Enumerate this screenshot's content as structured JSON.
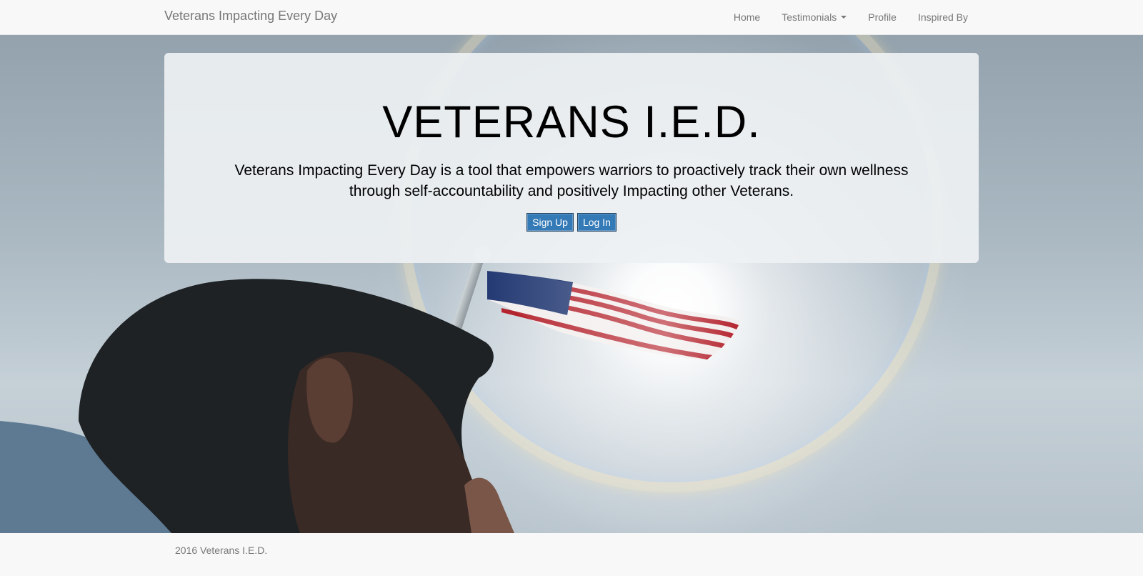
{
  "navbar": {
    "brand": "Veterans Impacting Every Day",
    "items": [
      {
        "label": "Home"
      },
      {
        "label": "Testimonials",
        "dropdown": true
      },
      {
        "label": "Profile"
      },
      {
        "label": "Inspired By"
      }
    ]
  },
  "hero": {
    "title": "VETERANS I.E.D.",
    "description": "Veterans Impacting Every Day is a tool that empowers warriors to proactively track their own wellness through self-accountability and positively Impacting other Veterans.",
    "signup_label": "Sign Up",
    "login_label": "Log In"
  },
  "footer": {
    "text": "2016 Veterans I.E.D."
  },
  "colors": {
    "navbar_bg": "#f8f8f8",
    "link": "#777777",
    "button": "#337ab7"
  }
}
